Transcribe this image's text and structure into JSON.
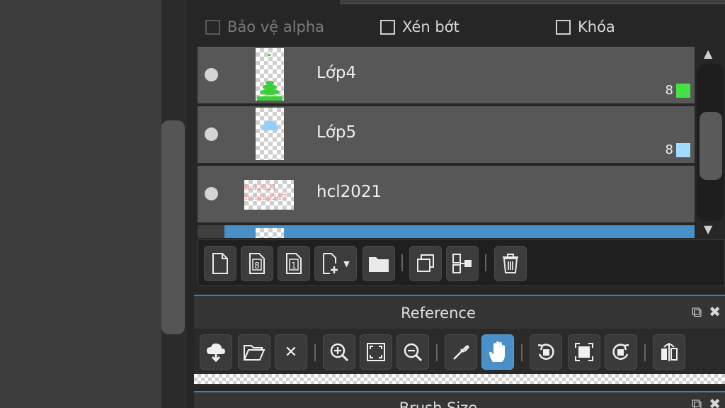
{
  "options": {
    "alpha_protect": "Bảo vệ alpha",
    "clipping": "Xén bớt",
    "lock": "Khóa"
  },
  "layers": [
    {
      "name": "Lớp4",
      "bit_depth": "8",
      "color": "#44e044"
    },
    {
      "name": "Lớp5",
      "bit_depth": "8",
      "color": "#9fdcff"
    },
    {
      "name": "hcl2021",
      "thumb_text_1": "hcl2021",
      "thumb_text_2": "hoidap247"
    }
  ],
  "reference_panel": {
    "title": "Reference"
  },
  "brush_panel": {
    "title": "Brush Size"
  },
  "colors": {
    "accent": "#4a90c8",
    "layer_bg": "#575757"
  }
}
